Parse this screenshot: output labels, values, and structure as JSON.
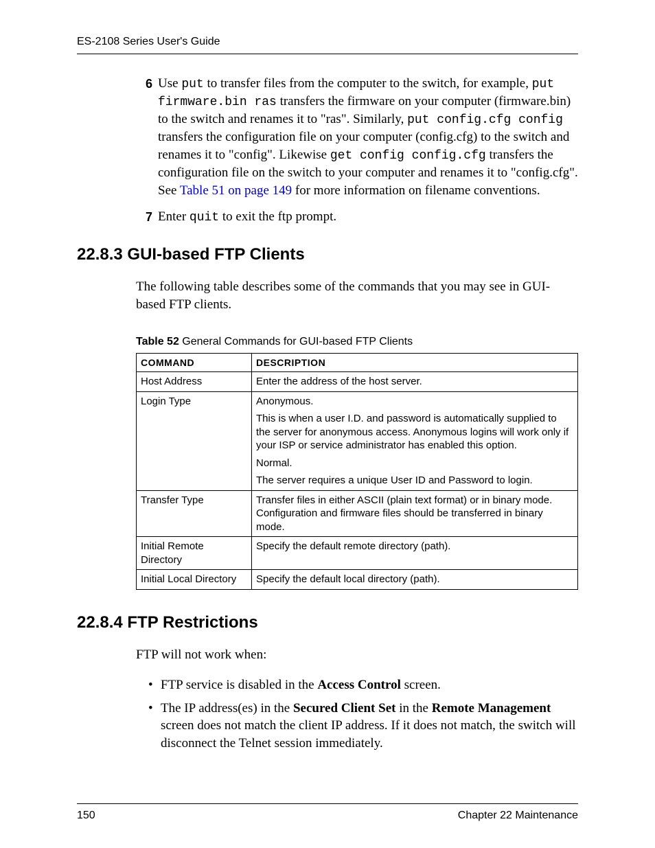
{
  "header": {
    "running": "ES-2108 Series User's Guide"
  },
  "steps": {
    "six": {
      "num": "6",
      "pre1": "Use ",
      "m1": "put",
      "post1": " to transfer files from the computer to the switch, for example, ",
      "m2": "put firmware.bin ras",
      "post2": " transfers the firmware on your computer (firmware.bin) to the switch and renames it to \"ras\". Similarly, ",
      "m3": "put config.cfg config",
      "post3": " transfers the configuration file on your computer (config.cfg) to the switch and renames it to \"config\". Likewise ",
      "m4": "get config config.cfg",
      "post4": " transfers the configuration file on the switch to your computer and renames it to \"config.cfg\". See ",
      "link": "Table 51 on page 149",
      "post5": " for more information on filename conventions."
    },
    "seven": {
      "num": "7",
      "pre": "Enter ",
      "m": "quit",
      "post": " to exit the ftp prompt."
    }
  },
  "sec2283": {
    "heading": "22.8.3  GUI-based FTP Clients",
    "intro": "The following table describes some of the commands that you may see in GUI-based FTP clients.",
    "caption_label": "Table 52",
    "caption_rest": "   General Commands for GUI-based FTP Clients",
    "th1": "COMMAND",
    "th2": "DESCRIPTION",
    "rows": [
      {
        "cmd": "Host Address",
        "desc": [
          "Enter the address of the host server."
        ]
      },
      {
        "cmd": "Login Type",
        "desc": [
          "Anonymous.",
          "This is when a user I.D. and password is automatically supplied to the server for anonymous access.  Anonymous logins will work only if your ISP or service administrator has enabled this option.",
          "Normal.",
          "The server requires a unique User ID and Password to login."
        ]
      },
      {
        "cmd": "Transfer Type",
        "desc": [
          "Transfer files in either ASCII (plain text format) or in binary mode. Configuration and firmware files should be transferred in binary mode."
        ]
      },
      {
        "cmd": "Initial Remote Directory",
        "desc": [
          "Specify the default remote directory (path)."
        ]
      },
      {
        "cmd": "Initial Local Directory",
        "desc": [
          "Specify the default local directory (path)."
        ]
      }
    ]
  },
  "sec2284": {
    "heading": "22.8.4  FTP Restrictions",
    "intro": "FTP will not work when:",
    "bullets": {
      "b1": {
        "pre": "FTP service is disabled in the ",
        "bold": "Access Control",
        "post": " screen."
      },
      "b2": {
        "pre": "The IP address(es) in the ",
        "bold1": "Secured Client Set",
        "mid": " in the ",
        "bold2": "Remote Management",
        "post": " screen does not match the client IP address.  If it does not match, the switch will disconnect the Telnet session immediately."
      }
    }
  },
  "footer": {
    "page": "150",
    "chapter": "Chapter 22 Maintenance"
  }
}
